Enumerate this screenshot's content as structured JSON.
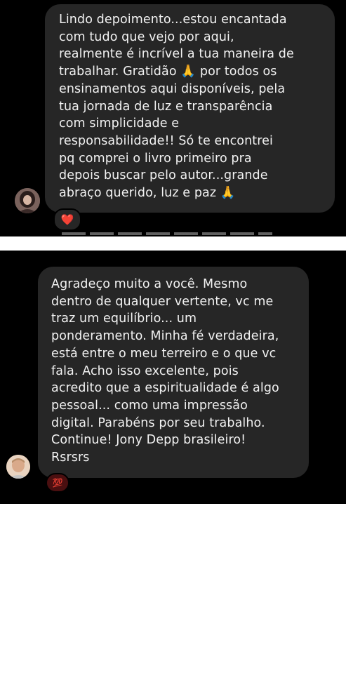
{
  "comments": [
    {
      "lines": [
        "Lindo depoimento...estou encantada",
        "com tudo que vejo por aqui,",
        "realmente é incrível a tua maneira de",
        "trabalhar. Gratidão 🙏 por todos os",
        "ensinamentos aqui disponíveis, pela",
        "tua jornada de luz e transparência",
        "com simplicidade e",
        "responsabilidade!! Só te encontrei",
        "pq comprei o livro primeiro pra",
        "depois buscar pelo autor...grande",
        "abraço querido, luz e paz 🙏"
      ],
      "reaction": "❤️",
      "avatar_icon": "user-avatar-woman"
    },
    {
      "lines": [
        "Agradeço muito a você. Mesmo",
        "dentro de qualquer vertente, vc me",
        "traz um equilíbrio... um",
        "ponderamento. Minha fé verdadeira,",
        "está entre o meu terreiro e o que vc",
        "fala. Acho isso excelente, pois",
        "acredito que a espiritualidade é algo",
        "pessoal... como uma impressão",
        "digital. Parabéns por seu trabalho.",
        "Continue! Jony Depp brasileiro!",
        "Rsrsrs"
      ],
      "reaction": "💯",
      "avatar_icon": "user-avatar-man"
    }
  ]
}
